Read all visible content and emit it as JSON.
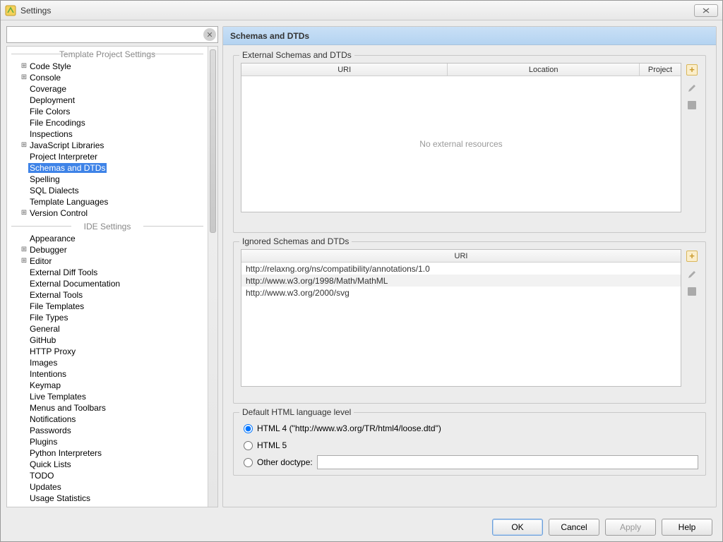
{
  "window": {
    "title": "Settings"
  },
  "search": {
    "placeholder": ""
  },
  "sections": {
    "template": {
      "label": "Template Project Settings",
      "items": [
        {
          "label": "Code Style",
          "expandable": true
        },
        {
          "label": "Console",
          "expandable": true
        },
        {
          "label": "Coverage"
        },
        {
          "label": "Deployment"
        },
        {
          "label": "File Colors"
        },
        {
          "label": "File Encodings"
        },
        {
          "label": "Inspections"
        },
        {
          "label": "JavaScript Libraries",
          "expandable": true
        },
        {
          "label": "Project Interpreter"
        },
        {
          "label": "Schemas and DTDs",
          "selected": true
        },
        {
          "label": "Spelling"
        },
        {
          "label": "SQL Dialects"
        },
        {
          "label": "Template Languages"
        },
        {
          "label": "Version Control",
          "expandable": true
        }
      ]
    },
    "ide": {
      "label": "IDE Settings",
      "items": [
        {
          "label": "Appearance"
        },
        {
          "label": "Debugger",
          "expandable": true
        },
        {
          "label": "Editor",
          "expandable": true
        },
        {
          "label": "External Diff Tools"
        },
        {
          "label": "External Documentation"
        },
        {
          "label": "External Tools"
        },
        {
          "label": "File Templates"
        },
        {
          "label": "File Types"
        },
        {
          "label": "General"
        },
        {
          "label": "GitHub"
        },
        {
          "label": "HTTP Proxy"
        },
        {
          "label": "Images"
        },
        {
          "label": "Intentions"
        },
        {
          "label": "Keymap"
        },
        {
          "label": "Live Templates"
        },
        {
          "label": "Menus and Toolbars"
        },
        {
          "label": "Notifications"
        },
        {
          "label": "Passwords"
        },
        {
          "label": "Plugins"
        },
        {
          "label": "Python Interpreters"
        },
        {
          "label": "Quick Lists"
        },
        {
          "label": "TODO"
        },
        {
          "label": "Updates"
        },
        {
          "label": "Usage Statistics"
        }
      ]
    }
  },
  "panel": {
    "title": "Schemas and DTDs",
    "external": {
      "legend": "External Schemas and DTDs",
      "cols": {
        "uri": "URI",
        "location": "Location",
        "project": "Project"
      },
      "empty": "No external resources"
    },
    "ignored": {
      "legend": "Ignored Schemas and DTDs",
      "col": "URI",
      "rows": [
        "http://relaxng.org/ns/compatibility/annotations/1.0",
        "http://www.w3.org/1998/Math/MathML",
        "http://www.w3.org/2000/svg"
      ]
    },
    "default_level": {
      "legend": "Default HTML language level",
      "html4": "HTML 4 (\"http://www.w3.org/TR/html4/loose.dtd\")",
      "html5": "HTML 5",
      "other": "Other doctype:",
      "other_value": ""
    }
  },
  "buttons": {
    "ok": "OK",
    "cancel": "Cancel",
    "apply": "Apply",
    "help": "Help"
  }
}
